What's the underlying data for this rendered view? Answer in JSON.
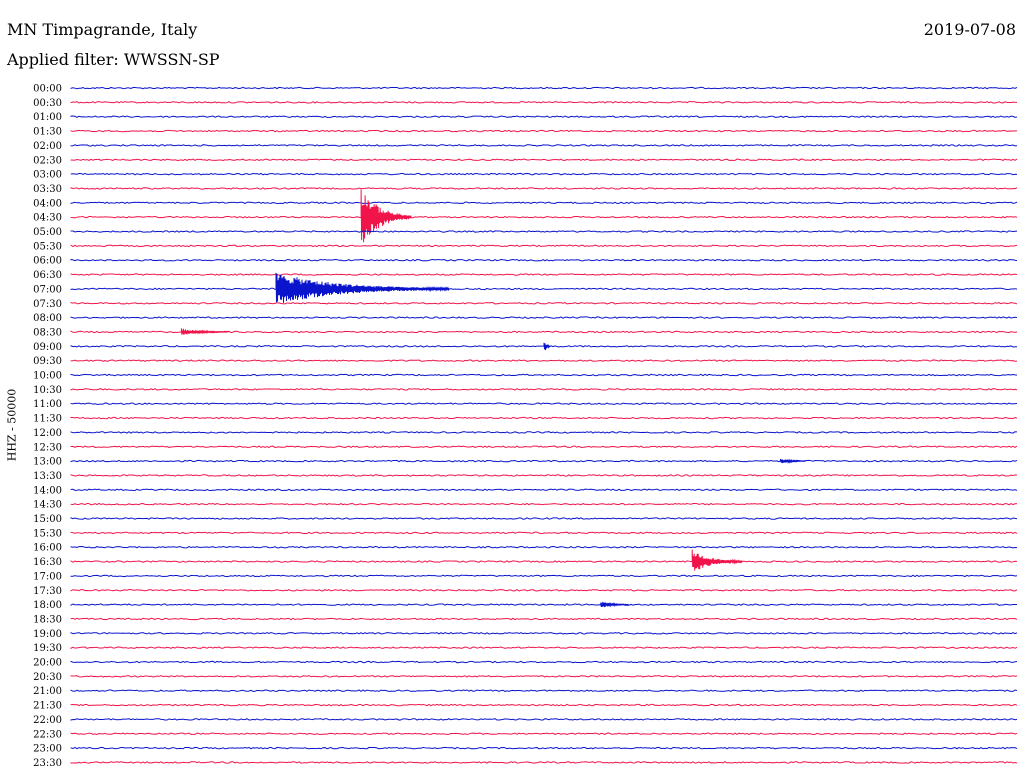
{
  "header": {
    "station": "MN Timpagrande, Italy",
    "filter": "Applied filter: WWSSN-SP",
    "date": "2019-07-08"
  },
  "chart_data": {
    "type": "line",
    "ylabel": "HHZ - 50000",
    "colors": {
      "odd": "#0a14cc",
      "even": "#f0144b"
    },
    "rows": [
      "00:00",
      "00:30",
      "01:00",
      "01:30",
      "02:00",
      "02:30",
      "03:00",
      "03:30",
      "04:00",
      "04:30",
      "05:00",
      "05:30",
      "06:00",
      "06:30",
      "07:00",
      "07:30",
      "08:00",
      "08:30",
      "09:00",
      "09:30",
      "10:00",
      "10:30",
      "11:00",
      "11:30",
      "12:00",
      "12:30",
      "13:00",
      "13:30",
      "14:00",
      "14:30",
      "15:00",
      "15:30",
      "16:00",
      "16:30",
      "17:00",
      "17:30",
      "18:00",
      "18:30",
      "19:00",
      "19:30",
      "20:00",
      "20:30",
      "21:00",
      "21:30",
      "22:00",
      "22:30",
      "23:00",
      "23:30"
    ],
    "events": [
      {
        "row": "04:30",
        "minute": 9.2,
        "amplitude": 1.0,
        "duration_min": 1.6
      },
      {
        "row": "07:00",
        "minute": 6.5,
        "amplitude": 0.55,
        "duration_min": 5.5
      },
      {
        "row": "08:30",
        "minute": 3.5,
        "amplitude": 0.12,
        "duration_min": 1.5
      },
      {
        "row": "09:00",
        "minute": 15.0,
        "amplitude": 0.25,
        "duration_min": 0.2
      },
      {
        "row": "13:00",
        "minute": 22.5,
        "amplitude": 0.1,
        "duration_min": 0.8
      },
      {
        "row": "16:30",
        "minute": 19.7,
        "amplitude": 0.4,
        "duration_min": 1.6
      },
      {
        "row": "18:00",
        "minute": 16.8,
        "amplitude": 0.12,
        "duration_min": 0.9
      }
    ]
  }
}
